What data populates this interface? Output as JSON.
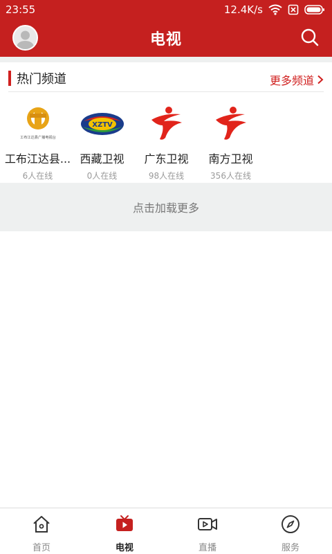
{
  "status_bar": {
    "time": "23:55",
    "speed": "12.4K/s"
  },
  "header": {
    "title": "电视"
  },
  "section": {
    "title": "热门频道",
    "more_label": "更多频道"
  },
  "channels": [
    {
      "name": "工布江达县...",
      "online": "6人在线",
      "logo_caption": "工布江达县广播电视台"
    },
    {
      "name": "西藏卫视",
      "online": "0人在线",
      "logo_text": "XZTV"
    },
    {
      "name": "广东卫视",
      "online": "98人在线"
    },
    {
      "name": "南方卫视",
      "online": "356人在线"
    }
  ],
  "load_more": "点击加载更多",
  "tabs": [
    {
      "label": "首页",
      "icon": "home-icon",
      "active": false
    },
    {
      "label": "电视",
      "icon": "tv-icon",
      "active": true
    },
    {
      "label": "直播",
      "icon": "live-video-icon",
      "active": false
    },
    {
      "label": "服务",
      "icon": "compass-icon",
      "active": false
    }
  ],
  "colors": {
    "primary": "#c5201f",
    "accent": "#d0201f"
  }
}
